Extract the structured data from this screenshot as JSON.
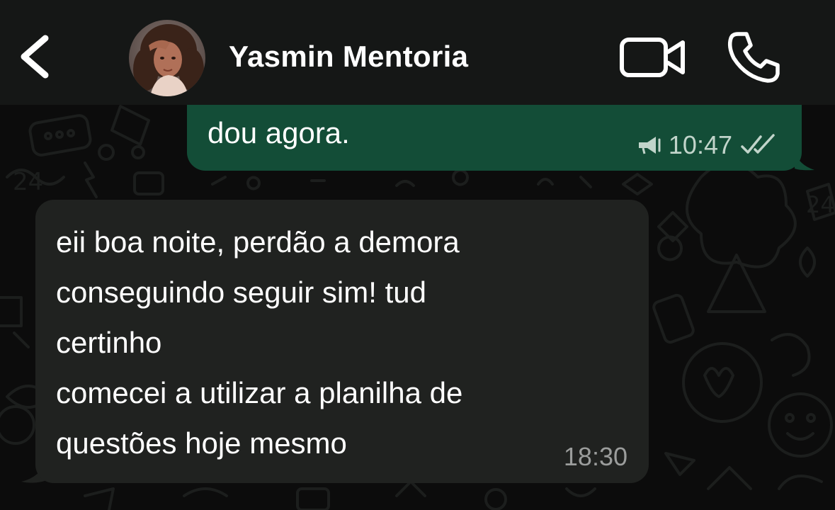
{
  "header": {
    "back_icon": "chevron-left-icon",
    "avatar_icon": "contact-photo",
    "contact_name": "Yasmin Mentoria",
    "video_icon": "video-camera-icon",
    "call_icon": "phone-icon",
    "background_color": "#151716"
  },
  "chat": {
    "wallpaper_color": "#0c0c0c",
    "messages": [
      {
        "direction": "outgoing",
        "text": "dou agora.",
        "time": "10:47",
        "status_icon": "double-check-read-icon",
        "extra_icon": "megaphone-icon",
        "bubble_color": "#134d37"
      },
      {
        "direction": "incoming",
        "text": "eii boa noite, perdão a demora\nconseguindo seguir sim! tud\ncertinho\ncomecei a utilizar a planilha de\nquestões hoje mesmo",
        "time": "18:30",
        "bubble_color": "#202220"
      }
    ]
  }
}
